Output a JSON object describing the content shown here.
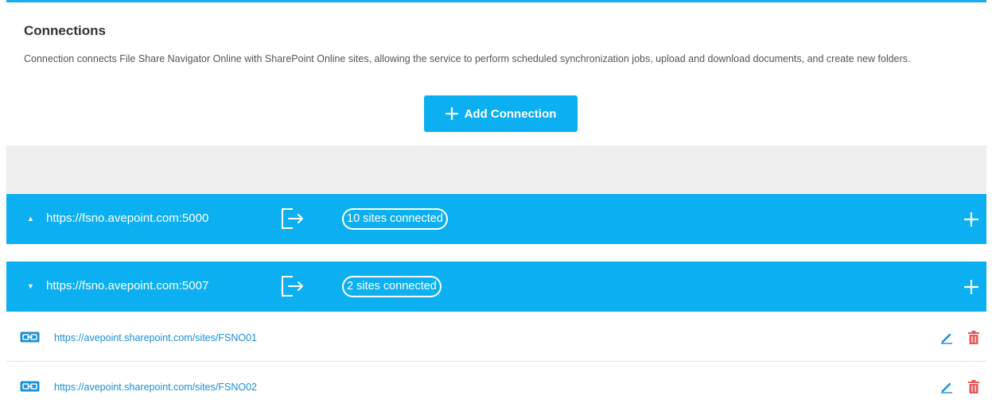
{
  "connections": {
    "title": "Connections",
    "description": "Connection connects File Share Navigator Online with SharePoint Online sites, allowing the service to perform scheduled synchronization jobs, upload and download documents, and create new folders.",
    "add_button_label": "Add Connection"
  },
  "groups": [
    {
      "url": "https://fsno.avepoint.com:5000",
      "state": "collapsed",
      "sites_badge": "10 sites connected",
      "sites": []
    },
    {
      "url": "https://fsno.avepoint.com:5007",
      "state": "expanded",
      "sites_badge": "2 sites connected",
      "sites": [
        {
          "url": "https://avepoint.sharepoint.com/sites/FSNO01"
        },
        {
          "url": "https://avepoint.sharepoint.com/sites/FSNO02"
        }
      ]
    }
  ],
  "icons": {
    "collapsed_caret": "caret-up-icon",
    "expanded_caret": "caret-down-icon",
    "exit": "sign-out-icon",
    "add": "plus-icon",
    "site_link": "link-icon",
    "edit": "pencil-icon",
    "delete": "trash-icon"
  },
  "colors": {
    "accent": "#0cb0f0",
    "link": "#1a8fd6",
    "delete": "#e8595a",
    "background_gray": "#efefef"
  }
}
